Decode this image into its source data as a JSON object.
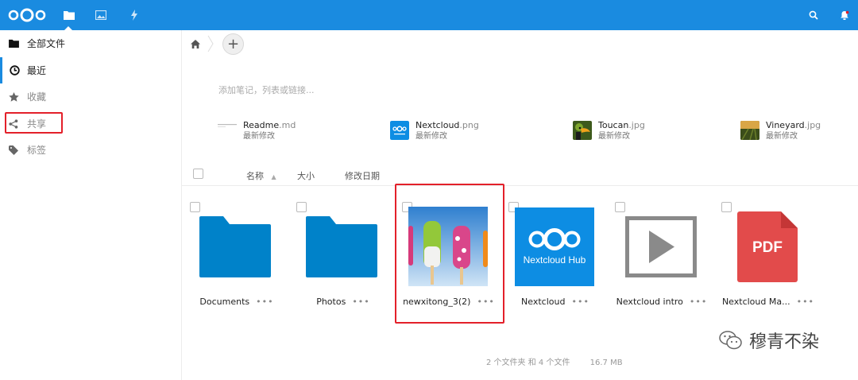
{
  "colors": {
    "topbar": "#1a8be0",
    "highlight_box": "#e3202a",
    "folder": "#0082c9",
    "pdf": "#e24b4b"
  },
  "topbar": {
    "apps": [
      {
        "name": "files",
        "icon": "folder-icon",
        "active": true
      },
      {
        "name": "photos",
        "icon": "image-icon",
        "active": false
      },
      {
        "name": "activity",
        "icon": "lightning-icon",
        "active": false
      }
    ],
    "right_icons": [
      "search-icon",
      "bell-icon"
    ]
  },
  "sidebar": {
    "items": [
      {
        "label": "全部文件",
        "icon": "folder-icon"
      },
      {
        "label": "最近",
        "icon": "clock-icon"
      },
      {
        "label": "收藏",
        "icon": "star-icon"
      },
      {
        "label": "共享",
        "icon": "share-icon"
      },
      {
        "label": "标签",
        "icon": "tag-icon"
      }
    ]
  },
  "notes_placeholder": "添加笔记，列表或链接...",
  "recent": [
    {
      "name": "Readme",
      "ext": ".md",
      "sub": "最新修改"
    },
    {
      "name": "Nextcloud",
      "ext": ".png",
      "sub": "最新修改"
    },
    {
      "name": "Toucan",
      "ext": ".jpg",
      "sub": "最新修改"
    },
    {
      "name": "Vineyard",
      "ext": ".jpg",
      "sub": "最新修改"
    }
  ],
  "columns": {
    "name": "名称",
    "sort_indicator": "▲",
    "size": "大小",
    "modified": "修改日期"
  },
  "files": [
    {
      "name": "Documents",
      "type": "folder"
    },
    {
      "name": "Photos",
      "type": "folder"
    },
    {
      "name": "newxitong_3(2)",
      "type": "image"
    },
    {
      "name": "Nextcloud",
      "type": "image"
    },
    {
      "name": "Nextcloud intro",
      "type": "video"
    },
    {
      "name": "Nextcloud Ma...",
      "type": "pdf"
    }
  ],
  "thumb_text": {
    "hub": "Nextcloud Hub",
    "pdf": "PDF"
  },
  "footer": {
    "summary": "2 个文件夹 和 4 个文件",
    "size": "16.7 MB"
  },
  "watermark": "穆青不染",
  "more_glyph": "•••"
}
